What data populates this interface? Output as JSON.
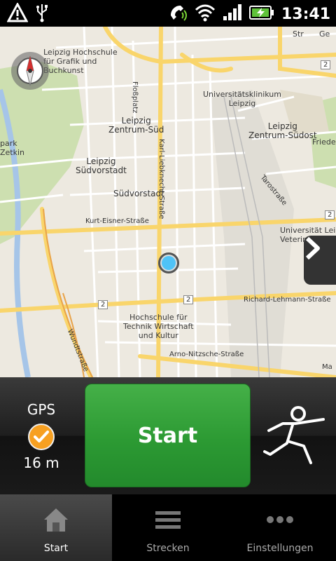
{
  "status_bar": {
    "time": "13:41",
    "icons": [
      "warning-icon",
      "usb-icon",
      "phone-speaker-icon",
      "wifi-icon",
      "signal-icon",
      "battery-charging-icon"
    ]
  },
  "map": {
    "labels": {
      "hochschule_grafik": "Leipzig Hochschule\nfür Grafik und\nBuchkunst",
      "uniklinikum": "Universitätsklinikum\nLeipzig",
      "zentrum_sued": "Leipzig\nZentrum-Süd",
      "zentrum_suedost": "Leipzig\nZentrum-Südost",
      "suedvorstadt_leipzig": "Leipzig\nSüdvorstadt",
      "suedvorstadt": "Südvorstadt",
      "uni_vet": "Universität Leipzig\nVeterin",
      "htwk": "Hochschule für\nTechnik Wirtschaft\nund Kultur",
      "park": "park\nZetkin",
      "frieden": "Frieden",
      "str_top": "Str",
      "ge_top": "Ge"
    },
    "streets": {
      "flossplatz": "Floßplatz",
      "karl_liebknecht": "Karl-Liebknecht-Straße",
      "kurt_eisner": "Kurt-Eisner-Straße",
      "richard_lehmann": "Richard-Lehmann-Straße",
      "arno_nitzsche": "Arno-Nitzsche-Straße",
      "wundtstrasse": "Wundtstraße",
      "tarostrasse": "Tarostraße",
      "ma": "Ma"
    },
    "road_numbers": [
      "2",
      "2",
      "2",
      "2"
    ],
    "icons": [
      "compass-icon",
      "location-marker-icon",
      "chevron-right-icon"
    ]
  },
  "controls": {
    "gps_label": "GPS",
    "gps_status_icon": "check-icon",
    "gps_accuracy": "16 m",
    "start_label": "Start",
    "activity_icon": "runner-icon"
  },
  "tabs": [
    {
      "label": "Start",
      "icon": "home-icon",
      "active": true
    },
    {
      "label": "Strecken",
      "icon": "list-icon",
      "active": false
    },
    {
      "label": "Einstellungen",
      "icon": "more-icon",
      "active": false
    }
  ],
  "colors": {
    "start_green": "#2c9a33",
    "gps_orange": "#f7a021",
    "map_bg": "#ede9e0",
    "road_yellow": "#f9d56b"
  }
}
